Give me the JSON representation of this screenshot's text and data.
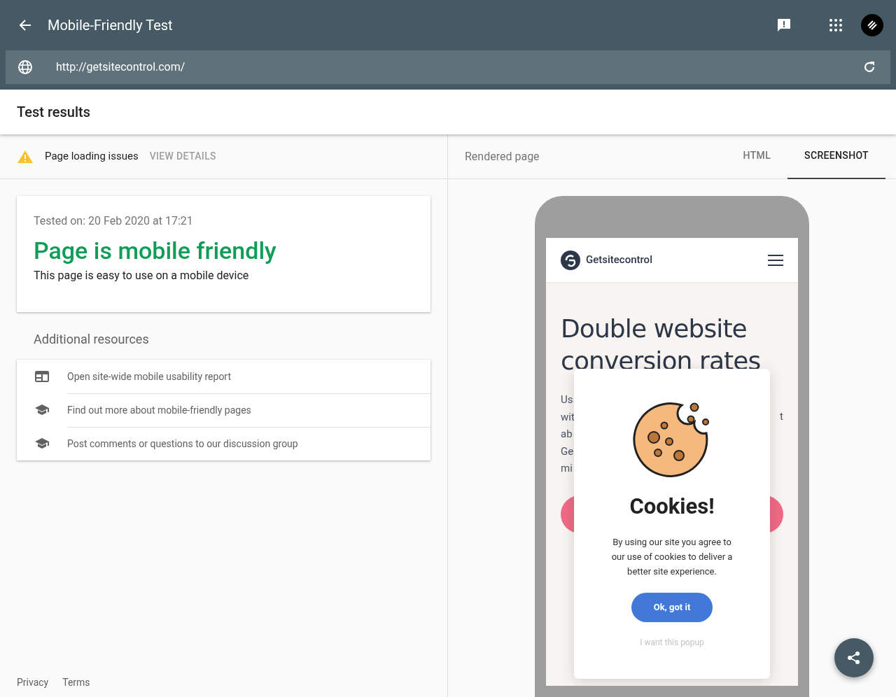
{
  "app_bar": {
    "title": "Mobile-Friendly Test"
  },
  "url_field": {
    "value": "http://getsitecontrol.com/"
  },
  "section_title": "Test results",
  "issues": {
    "label": "Page loading issues",
    "action": "VIEW DETAILS"
  },
  "preview_header": {
    "title": "Rendered page",
    "tabs": [
      {
        "label": "HTML",
        "selected": false
      },
      {
        "label": "SCREENSHOT",
        "selected": true
      }
    ]
  },
  "result": {
    "tested_on": "Tested on: 20 Feb 2020 at 17:21",
    "headline": "Page is mobile friendly",
    "description": "This page is easy to use on a mobile device"
  },
  "resources": {
    "title": "Additional resources",
    "items": [
      {
        "kind": "report",
        "label": "Open site-wide mobile usability report"
      },
      {
        "kind": "school",
        "label": "Find out more about mobile-friendly pages"
      },
      {
        "kind": "school",
        "label": "Post comments or questions to our discussion group"
      }
    ]
  },
  "footer": {
    "links": [
      "Privacy",
      "Terms"
    ]
  },
  "phone": {
    "brand": "Getsitecontrol",
    "hero_title": "Double website conversion rates",
    "hero_fragments_left": [
      "Us",
      "wit",
      "ab",
      "Ge",
      "mi"
    ],
    "hero_fragment_right": "t",
    "popup": {
      "title": "Cookies!",
      "text": "By using our site you agree to our use of cookies to deliver a better site experience.",
      "button": "Ok, got it",
      "link": "I want this popup"
    }
  }
}
